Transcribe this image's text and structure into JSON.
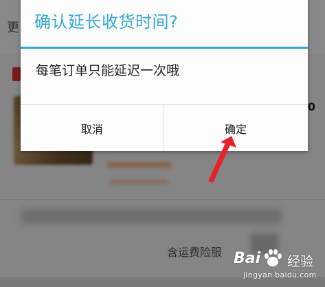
{
  "background": {
    "top_left_char": "更",
    "price_fragment": "0",
    "insurance_text": "含运费险服"
  },
  "dialog": {
    "title": "确认延长收货时间?",
    "message": "每笔订单只能延迟一次哦",
    "cancel_label": "取消",
    "confirm_label": "确定",
    "accent_color": "#33a8d8"
  },
  "annotation": {
    "arrow_color": "#e8202a"
  },
  "watermark": {
    "brand_left": "Bai",
    "brand_right": "经验",
    "url": "jingyan.baidu.com",
    "paw_icon": "baidu-paw-icon"
  }
}
